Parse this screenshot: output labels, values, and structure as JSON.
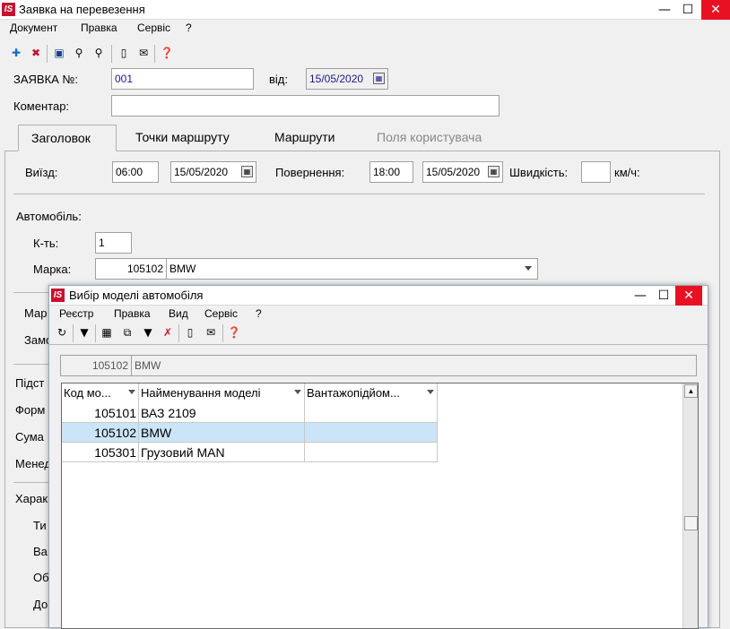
{
  "window": {
    "title": "Заявка на перевезення",
    "logo": "IS",
    "minimize": "—",
    "maximize": "☐",
    "close": "✕"
  },
  "menu": [
    "Документ",
    "Правка",
    "Сервіс",
    "?"
  ],
  "toolbar_icons": [
    "add-doc-icon",
    "delete-doc-icon",
    "save-icon",
    "search-icon",
    "find-replace-icon",
    "page-icon",
    "mail-icon",
    "help-icon"
  ],
  "header": {
    "request_label": "ЗАЯВКА №:",
    "request_value": "001",
    "from_label": "від:",
    "from_date": "15/05/2020",
    "comment_label": "Коментар:",
    "comment_value": ""
  },
  "tabs": [
    {
      "label": "Заголовок"
    },
    {
      "label": "Точки маршруту"
    },
    {
      "label": "Маршрути"
    },
    {
      "label": "Поля користувача"
    }
  ],
  "trip": {
    "departure_label": "Виїзд:",
    "departure_time": "06:00",
    "departure_date": "15/05/2020",
    "return_label": "Повернення:",
    "return_time": "18:00",
    "return_date": "15/05/2020",
    "speed_label": "Швидкість:",
    "speed_value": "",
    "speed_unit": "км/ч:"
  },
  "car": {
    "section_label": "Автомобіль:",
    "count_label": "К-ть:",
    "count_value": "1",
    "brand_label": "Марка:",
    "brand_code": "105102",
    "brand_name": "BMW"
  },
  "hidden_labels": [
    "Мар",
    "Замо",
    "Підст",
    "Форм",
    "Сума",
    "Менед",
    "Харак",
    "Ти",
    "Ва",
    "Об",
    "До"
  ],
  "dialog": {
    "title": "Вибір моделі автомобіля",
    "logo": "IS",
    "minimize": "—",
    "maximize": "☐",
    "close": "✕",
    "menu": [
      "Реєстр",
      "Правка",
      "Вид",
      "Сервіс",
      "?"
    ],
    "toolbar_icons": [
      "refresh-icon",
      "filter-icon",
      "table-icon",
      "copy-icon",
      "funnel-icon",
      "clear-filter-icon",
      "page-icon",
      "mail-icon",
      "help-icon"
    ],
    "selected_code": "105102",
    "selected_name": "BMW",
    "columns": [
      "Код мо...",
      "Найменування моделі",
      "Вантажопідйом..."
    ],
    "rows": [
      {
        "code": "105101",
        "name": "ВАЗ 2109",
        "capacity": "",
        "selected": false
      },
      {
        "code": "105102",
        "name": "BMW",
        "capacity": "",
        "selected": true
      },
      {
        "code": "105301",
        "name": "Грузовий MAN",
        "capacity": "",
        "selected": false
      }
    ]
  }
}
